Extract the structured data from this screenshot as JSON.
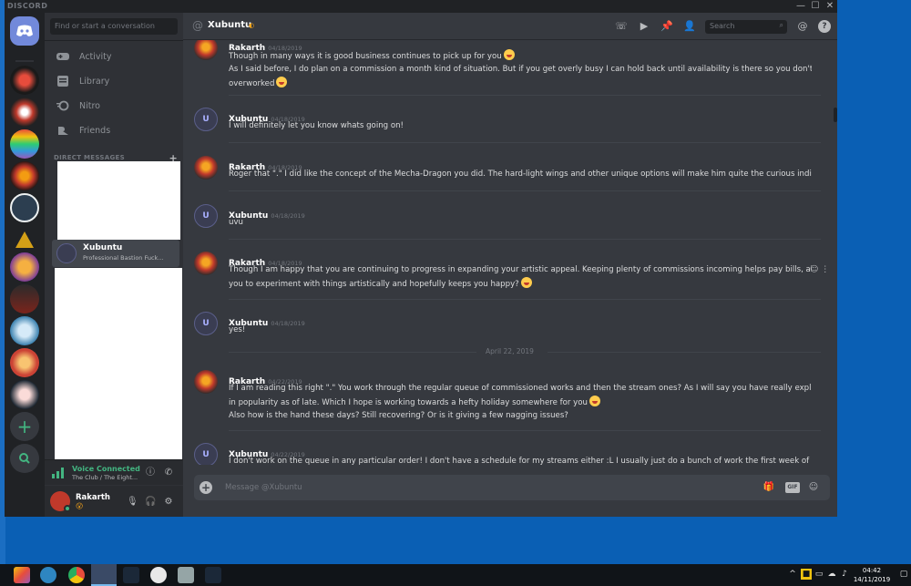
{
  "window": {
    "brand": "DISCORD",
    "controls": [
      "—",
      "☐",
      "✕"
    ]
  },
  "sidebar": {
    "search_placeholder": "Find or start a conversation",
    "nav": [
      {
        "label": "Activity",
        "icon": "gamepad-icon"
      },
      {
        "label": "Library",
        "icon": "library-icon"
      },
      {
        "label": "Nitro",
        "icon": "nitro-icon"
      },
      {
        "label": "Friends",
        "icon": "friends-icon"
      }
    ],
    "dm_header": "DIRECT MESSAGES",
    "dm_active": {
      "name": "Xubuntu",
      "status": "Professional Bastion Fuck..."
    },
    "voice": {
      "status": "Voice Connected",
      "channel": "The Club / The Eight..."
    },
    "user": {
      "name": "Rakarth",
      "status_emoji": "😮"
    }
  },
  "chat": {
    "title": "Xubuntu",
    "search_placeholder": "Search",
    "composer_placeholder": "Message @Xubuntu",
    "gif_label": "GIF",
    "date_divider": "April 22, 2019",
    "messages": [
      {
        "author": "Rakarth",
        "time": "04/18/2019",
        "avatar": "rakarth",
        "lines": [
          "Though in many ways it is good business continues to pick up for you",
          "As I said before, I do plan on a commission a month kind of situation. But if you get overly busy I can hold back until availability is there so you don't feel",
          "overworked"
        ]
      },
      {
        "author": "Xubuntu",
        "time": "04/18/2019",
        "avatar": "xubuntu",
        "lines": [
          "I will definitely let you know whats going on!"
        ]
      },
      {
        "author": "Rakarth",
        "time": "04/18/2019",
        "avatar": "rakarth",
        "lines": [
          "Roger that \".\" I did like the concept of the Mecha-Dragon you did. The hard-light wings and other unique options will make him quite the curious individual."
        ]
      },
      {
        "author": "Xubuntu",
        "time": "04/18/2019",
        "avatar": "xubuntu",
        "lines": [
          "uvu"
        ]
      },
      {
        "author": "Rakarth",
        "time": "04/18/2019",
        "avatar": "rakarth",
        "lines": [
          "Though I am happy that you are continuing to progress in expanding your artistic appeal. Keeping plenty of commissions incoming helps pay bills, allows",
          "you to experiment with things artistically and hopefully keeps you happy?"
        ]
      },
      {
        "author": "Xubuntu",
        "time": "04/18/2019",
        "avatar": "xubuntu",
        "lines": [
          "yes!"
        ]
      },
      {
        "author": "Rakarth",
        "time": "04/22/2019",
        "avatar": "rakarth",
        "lines": [
          "If I am reading this right \".\" You work through the regular queue of commissioned works and then the stream ones? As I will say you have really exploded",
          "in popularity as of late. Which I hope is working towards a hefty holiday somewhere for you",
          "Also how is the hand these days? Still recovering? Or is it giving a few nagging issues?"
        ]
      },
      {
        "author": "Xubuntu",
        "time": "04/22/2019",
        "avatar": "xubuntu",
        "lines": [
          "I don't work on the queue in any particular order! I don't have a schedule for my streams either :L I usually just do a bunch of work the first week of the"
        ]
      }
    ]
  },
  "taskbar": {
    "time": "04:42",
    "date": "14/11/2019"
  },
  "colors": {
    "accent": "#7289da",
    "online": "#43b581",
    "background": "#36393f",
    "sidebar": "#2f3136",
    "desktop": "#0a5fb4"
  }
}
